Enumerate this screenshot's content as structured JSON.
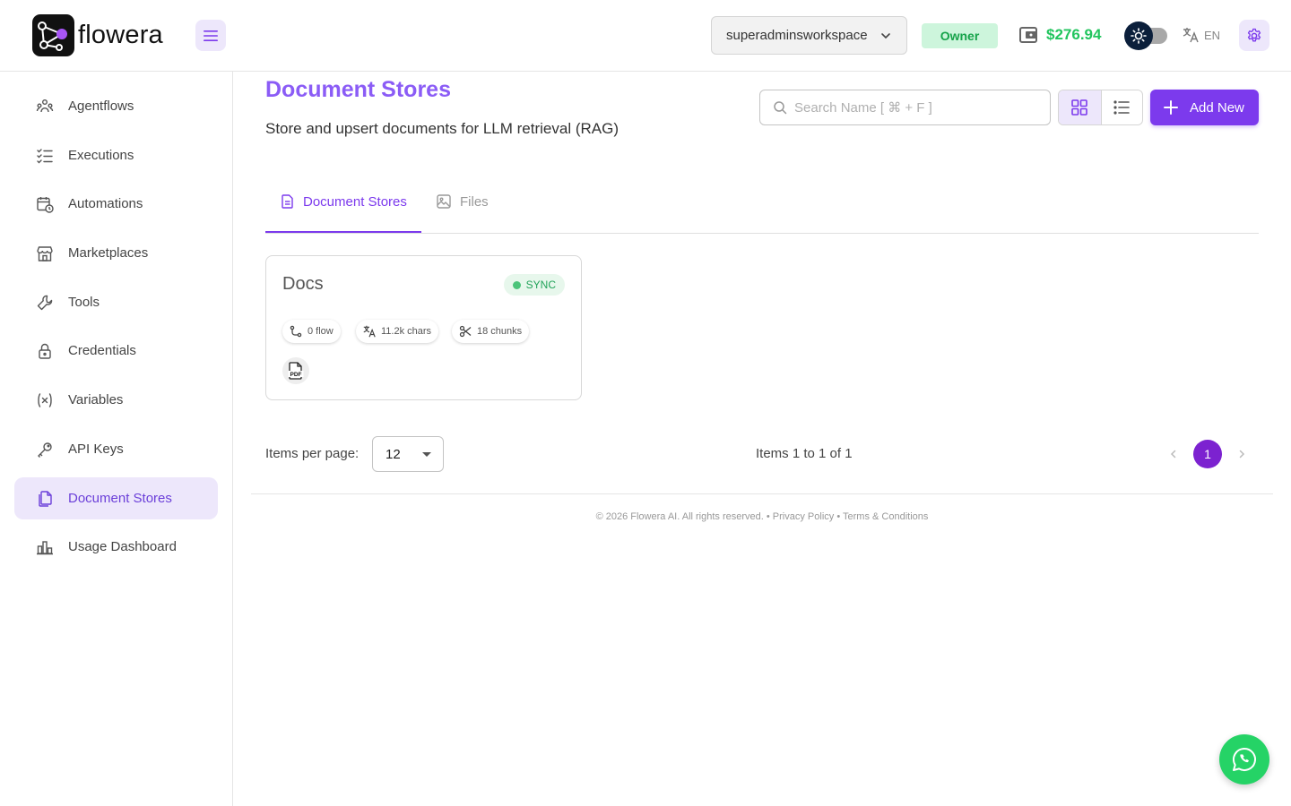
{
  "brand": {
    "name": "flowera"
  },
  "header": {
    "workspace": "superadminsworkspace",
    "role": "Owner",
    "balance": "$276.94",
    "language": "EN"
  },
  "sidebar": {
    "items": [
      {
        "label": "Agentflows",
        "icon": "agents-icon"
      },
      {
        "label": "Executions",
        "icon": "checklist-icon"
      },
      {
        "label": "Automations",
        "icon": "calendar-clock-icon"
      },
      {
        "label": "Marketplaces",
        "icon": "storefront-icon"
      },
      {
        "label": "Tools",
        "icon": "wrench-icon"
      },
      {
        "label": "Credentials",
        "icon": "lock-icon"
      },
      {
        "label": "Variables",
        "icon": "variable-icon"
      },
      {
        "label": "API Keys",
        "icon": "key-icon"
      },
      {
        "label": "Document Stores",
        "icon": "files-icon",
        "active": true
      },
      {
        "label": "Usage Dashboard",
        "icon": "bar-chart-icon"
      }
    ]
  },
  "main": {
    "title": "Document Stores",
    "subtitle": "Store and upsert documents for LLM retrieval (RAG)",
    "search_placeholder": "Search Name [ ⌘ + F ]",
    "add_label": "Add New",
    "tabs": [
      {
        "label": "Document Stores",
        "active": true
      },
      {
        "label": "Files",
        "active": false
      }
    ],
    "cards": [
      {
        "name": "Docs",
        "status": "SYNC",
        "flows": "0 flow",
        "chars": "11.2k chars",
        "chunks": "18 chunks",
        "file_type": "PDF"
      }
    ],
    "pagination": {
      "items_per_page_label": "Items per page:",
      "items_per_page": "12",
      "range": "Items 1 to 1 of 1",
      "current_page": "1"
    }
  },
  "footer": {
    "copyright": "© 2026 Flowera AI. All rights reserved.",
    "separator": " • ",
    "privacy": "Privacy Policy",
    "terms": "Terms & Conditions"
  },
  "colors": {
    "accent": "#7c3aed",
    "accent_light": "#ede7fb",
    "success": "#22c55e"
  }
}
